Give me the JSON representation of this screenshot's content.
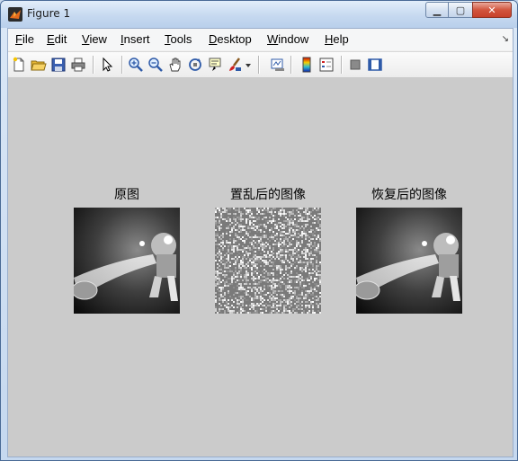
{
  "window": {
    "title": "Figure 1",
    "accent": "#c7402a"
  },
  "caption_buttons": {
    "minimize": "▁",
    "maximize": "▢",
    "close": "✕"
  },
  "menu": {
    "items": [
      {
        "label_u": "F",
        "label_rest": "ile"
      },
      {
        "label_u": "E",
        "label_rest": "dit"
      },
      {
        "label_u": "V",
        "label_rest": "iew"
      },
      {
        "label_u": "I",
        "label_rest": "nsert"
      },
      {
        "label_u": "T",
        "label_rest": "ools"
      },
      {
        "label_u": "D",
        "label_rest": "esktop"
      },
      {
        "label_u": "W",
        "label_rest": "indow"
      },
      {
        "label_u": "H",
        "label_rest": "elp"
      }
    ],
    "dock_glyph": "↘"
  },
  "toolbar": {
    "icons": [
      "new-figure-icon",
      "open-file-icon",
      "save-icon",
      "print-icon",
      "pointer-icon",
      "zoom-in-icon",
      "zoom-out-icon",
      "pan-icon",
      "rotate-3d-icon",
      "data-cursor-icon",
      "brush-icon",
      "brush-dropdown-icon",
      "link-plot-icon",
      "colorbar-icon",
      "legend-icon",
      "hide-plot-tools-icon",
      "show-plot-tools-icon"
    ]
  },
  "figure": {
    "background": "#cbcbcb",
    "subplots": [
      {
        "title": "原图"
      },
      {
        "title": "置乱后的图像"
      },
      {
        "title": "恢复后的图像"
      }
    ]
  }
}
